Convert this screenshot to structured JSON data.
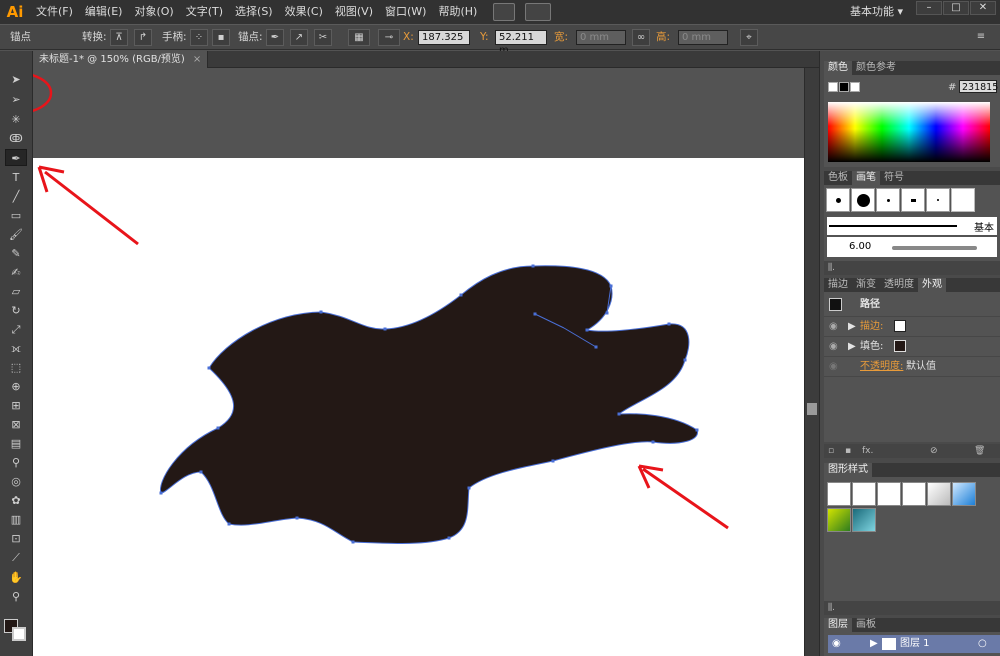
{
  "app": {
    "logo": "Ai"
  },
  "menu": [
    "文件(F)",
    "编辑(E)",
    "对象(O)",
    "文字(T)",
    "选择(S)",
    "效果(C)",
    "视图(V)",
    "窗口(W)",
    "帮助(H)"
  ],
  "workspace": {
    "label": "基本功能"
  },
  "window_buttons": [
    "–",
    "□",
    "✕"
  ],
  "control_bar": {
    "selection_label": "锚点",
    "convert_label": "转换:",
    "handles_label": "手柄:",
    "anchor_label": "锚点:",
    "x_label": "X:",
    "x_value": "187.325",
    "y_label": "Y:",
    "y_value": "52.211 m",
    "w_label": "宽:",
    "w_value": "0 mm",
    "h_label": "高:",
    "h_value": "0 mm"
  },
  "document_tab": {
    "title": "未标题-1* @ 150% (RGB/预览)",
    "close": "×"
  },
  "canvas": {
    "shape_color": "#231815",
    "path_color": "#4a6fd6",
    "arrow_color": "#e8141a"
  },
  "panels": {
    "color": {
      "tabs": [
        "颜色",
        "颜色参考"
      ],
      "hex_label": "#",
      "hex_value": "231815"
    },
    "brushes": {
      "tabs": [
        "色板",
        "画笔",
        "符号"
      ],
      "basic_label": "基本",
      "size_value": "6.00"
    },
    "appearance": {
      "tabs": [
        "描边",
        "渐变",
        "透明度",
        "外观"
      ],
      "title": "路径",
      "stroke_label": "描边:",
      "fill_label": "填色:",
      "opacity_label": "不透明度:",
      "opacity_value": "默认值",
      "fx_label": "fx."
    },
    "graphic_styles": {
      "tabs": [
        "图形样式"
      ]
    },
    "layers": {
      "tabs": [
        "图层",
        "画板"
      ],
      "layer_name": "图层 1"
    }
  }
}
